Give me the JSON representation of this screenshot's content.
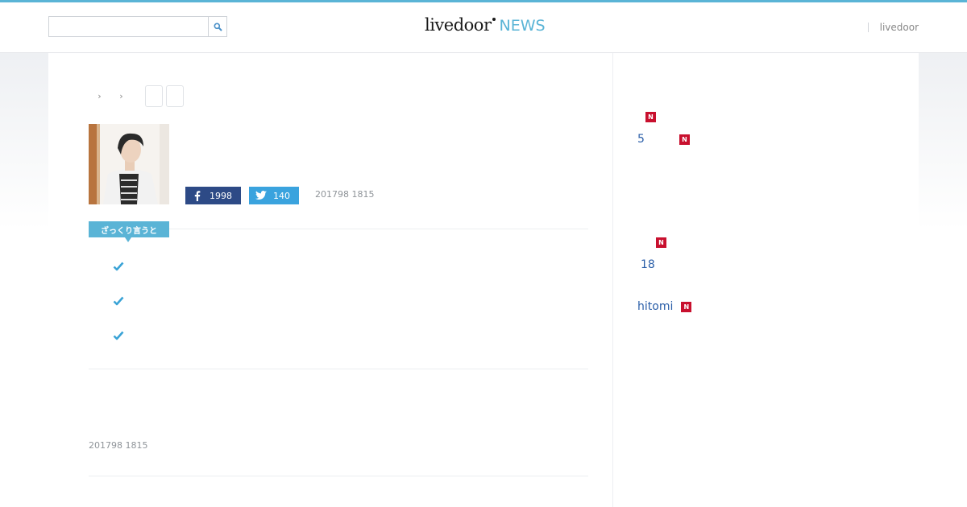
{
  "header": {
    "search_placeholder": "",
    "logo_main": "livedoor",
    "logo_news": "NEWS",
    "right_link": "livedoor"
  },
  "article": {
    "share": {
      "facebook_count": "1998",
      "twitter_count": "140"
    },
    "published": "201798 1815",
    "summary_label": "ざっくり言うと",
    "published_bottom": "201798 1815"
  },
  "sidebar": {
    "badge_label": "N",
    "items": [
      {
        "text": ""
      },
      {
        "text": "5"
      },
      {
        "text": ""
      },
      {
        "text": "18"
      },
      {
        "text": "hitomi"
      }
    ]
  },
  "colors": {
    "accent": "#5ab4d6",
    "facebook": "#2d4a86",
    "twitter": "#3aa3de",
    "new_badge": "#c8102e",
    "link": "#2a5ea8"
  },
  "icons": [
    "search-icon",
    "facebook-icon",
    "twitter-icon",
    "check-icon",
    "chevron-right-icon"
  ]
}
